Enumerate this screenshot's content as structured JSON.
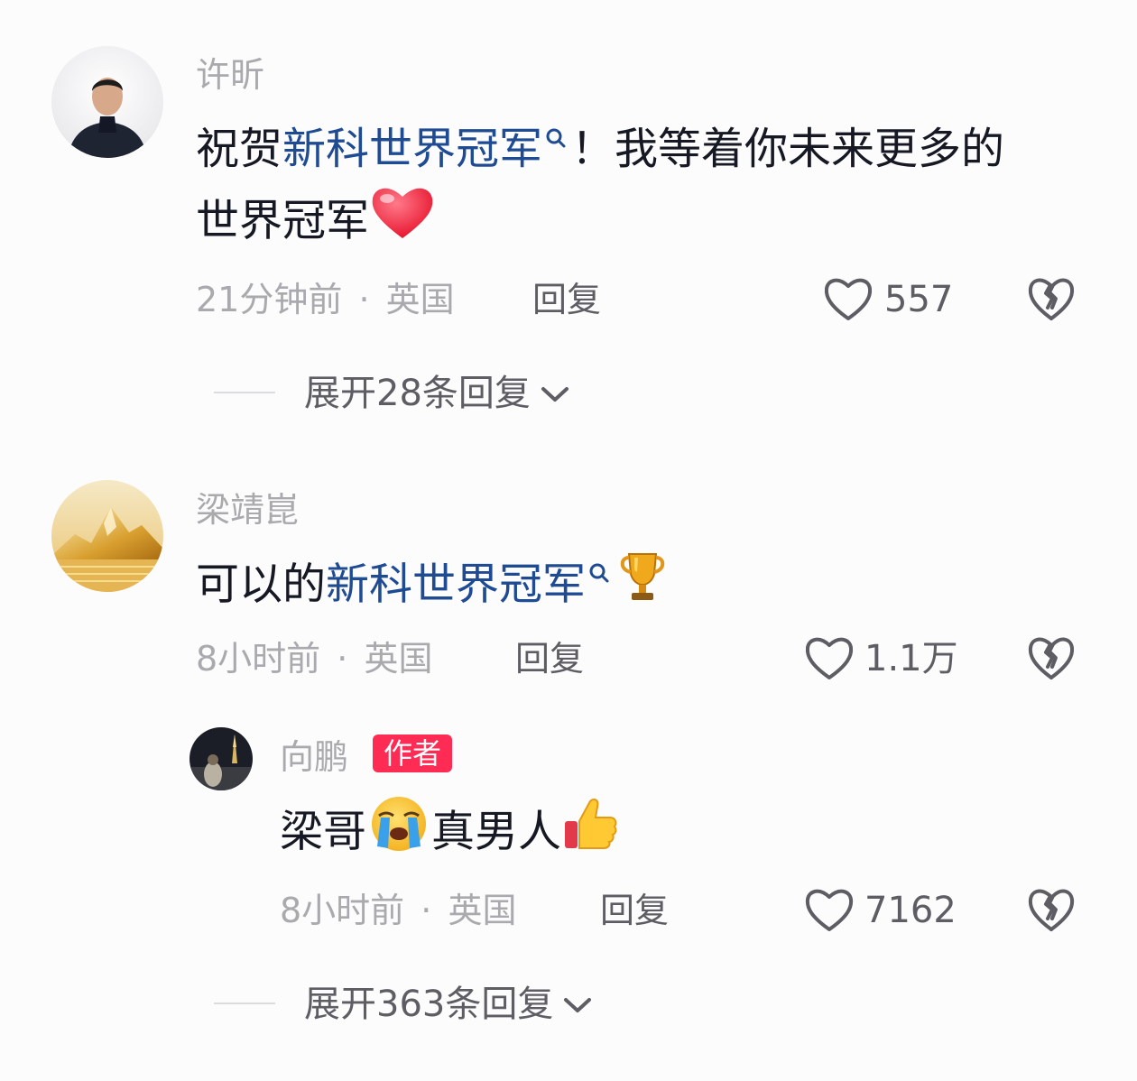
{
  "comments": [
    {
      "author": "许昕",
      "text_pre": "祝贺",
      "link": "新科世界冠军",
      "text_post_1": "！我等着你未来更多的",
      "text_line2": "世界冠军",
      "emoji_1": "red-heart",
      "time": "21分钟前",
      "separator": "·",
      "location": "英国",
      "reply_label": "回复",
      "likes": "557",
      "expand_label": "展开28条回复"
    },
    {
      "author": "梁靖崑",
      "text_pre": "可以的",
      "link": "新科世界冠军",
      "emoji_1": "trophy",
      "time": "8小时前",
      "separator": "·",
      "location": "英国",
      "reply_label": "回复",
      "likes": "1.1万",
      "reply": {
        "author": "向鹏",
        "badge": "作者",
        "text_1": "梁哥",
        "emoji_1": "loudly-crying-face",
        "text_2": "真男人",
        "emoji_2": "thumbs-up",
        "time": "8小时前",
        "separator": "·",
        "location": "英国",
        "reply_label": "回复",
        "likes": "7162"
      },
      "expand_label": "展开363条回复"
    }
  ],
  "colors": {
    "link": "#1f4b93",
    "badge": "#fe2c55",
    "muted": "#a9a9ae",
    "action": "#5d5d63"
  }
}
